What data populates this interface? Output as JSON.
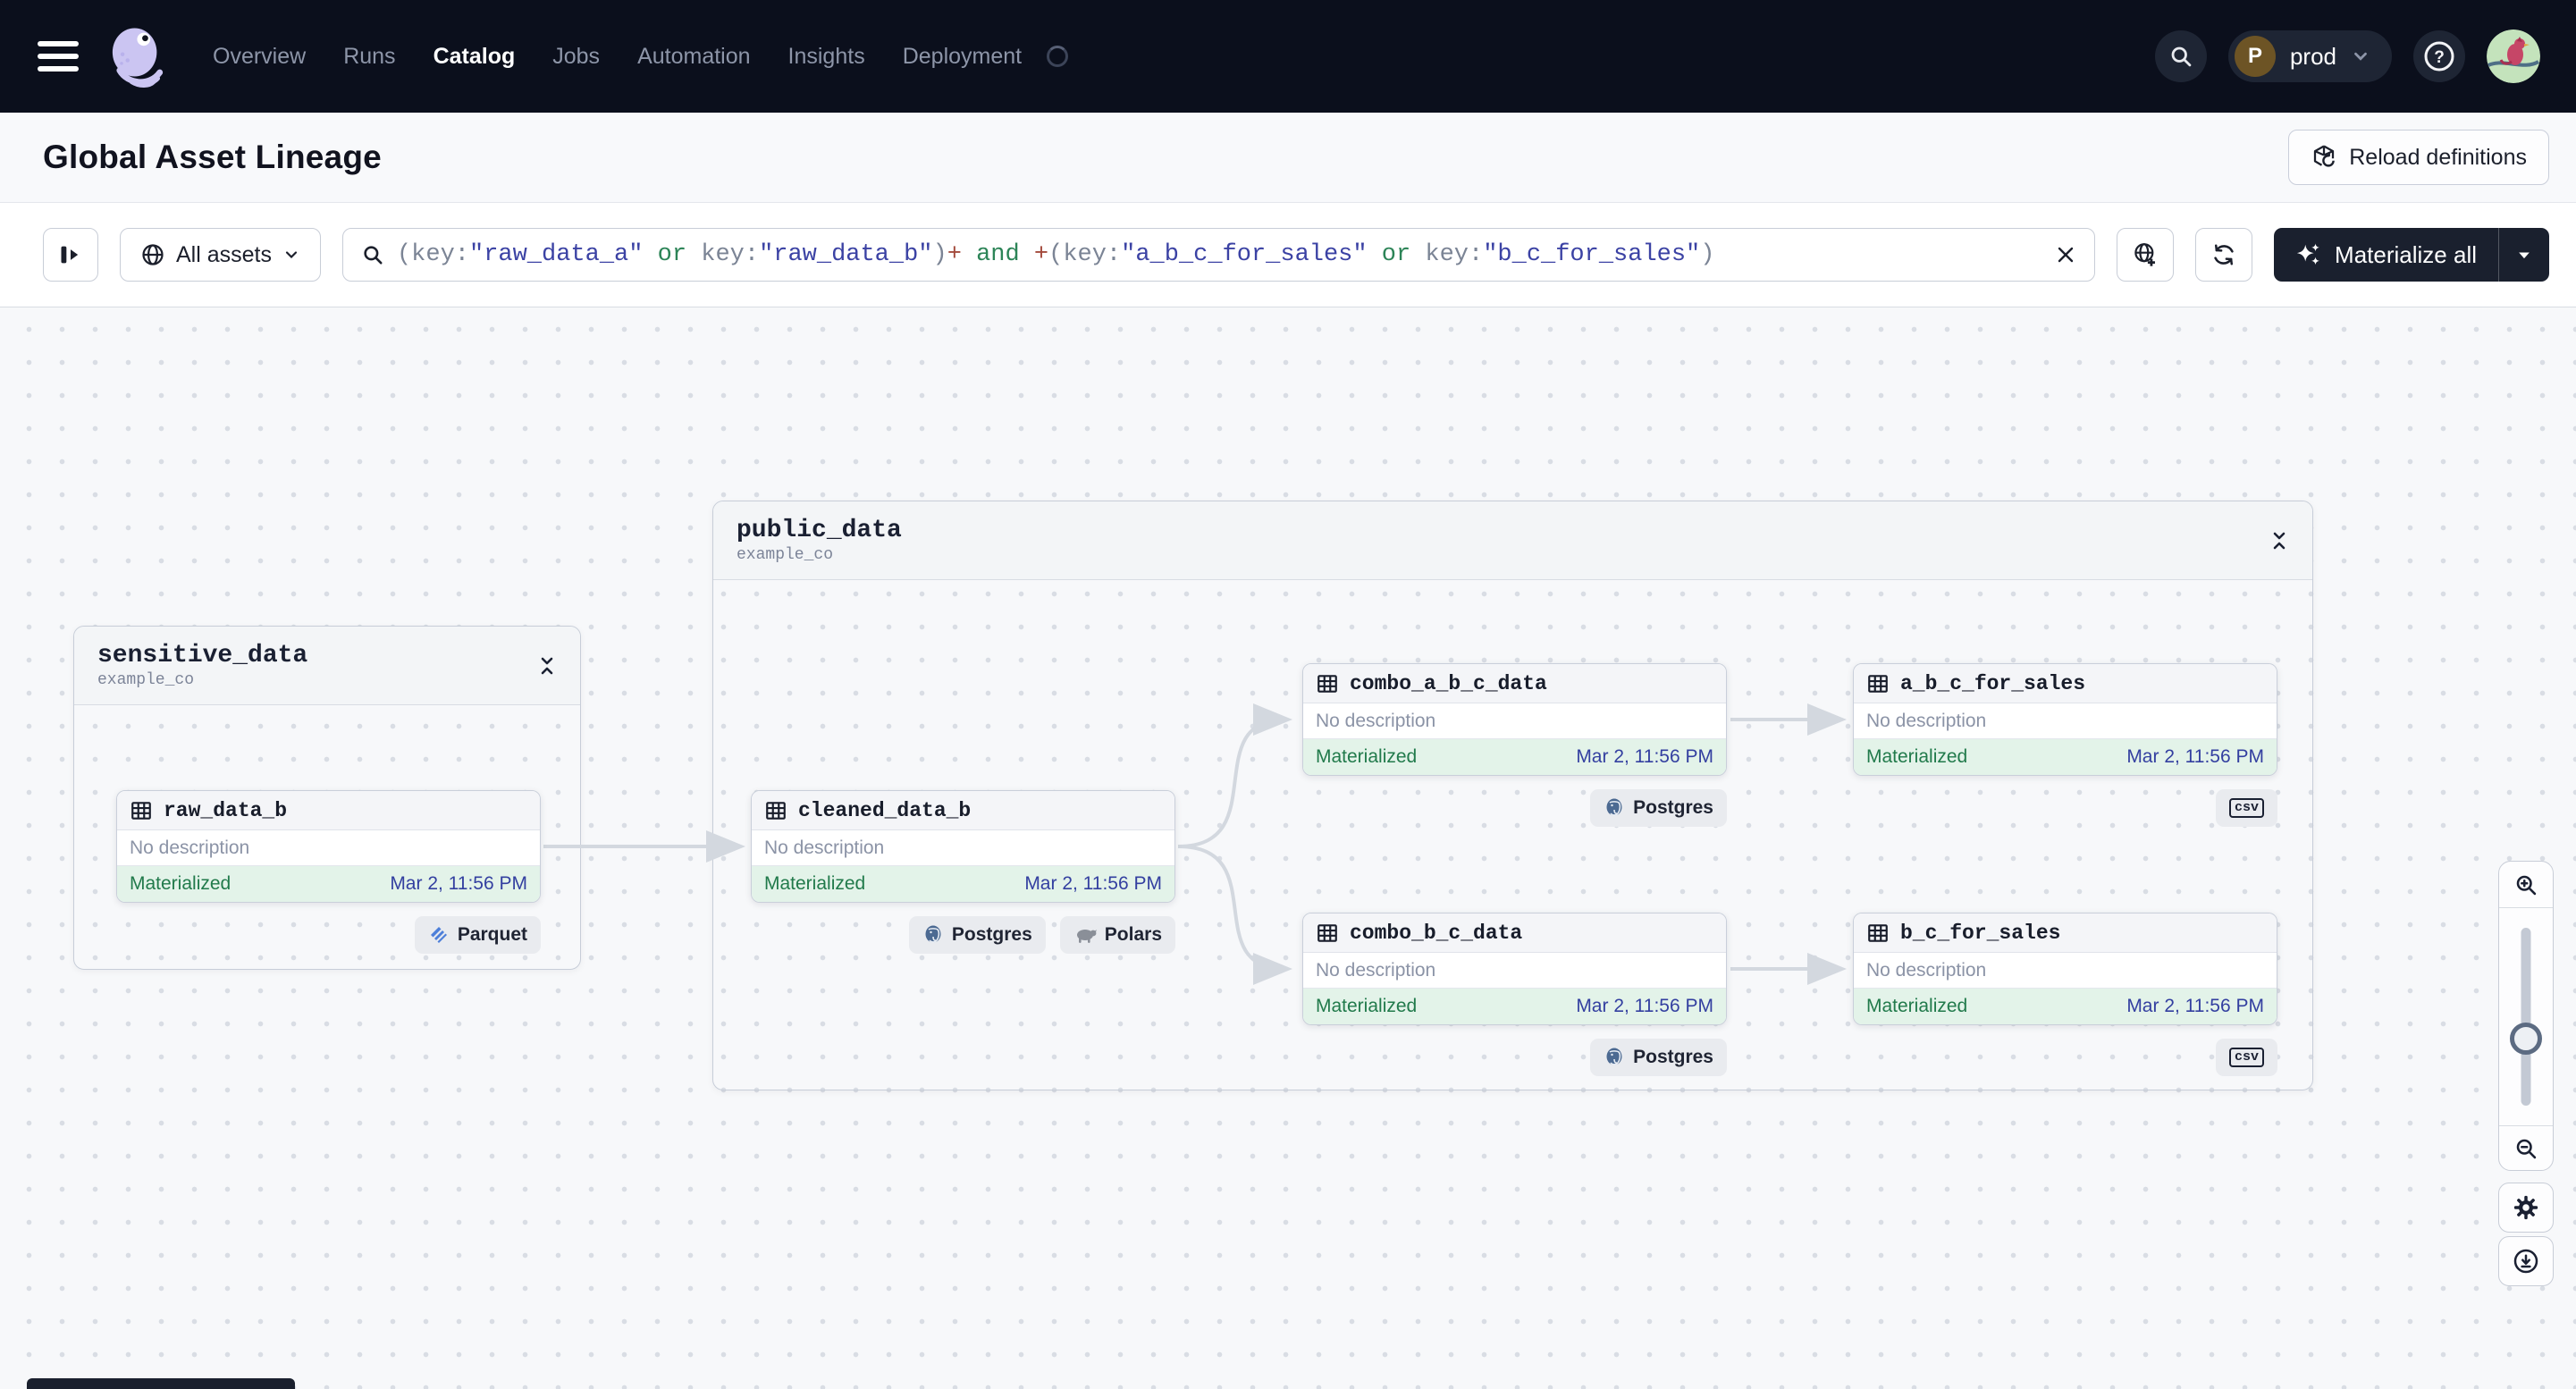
{
  "nav": {
    "items": [
      {
        "label": "Overview",
        "active": false
      },
      {
        "label": "Runs",
        "active": false
      },
      {
        "label": "Catalog",
        "active": true
      },
      {
        "label": "Jobs",
        "active": false
      },
      {
        "label": "Automation",
        "active": false
      },
      {
        "label": "Insights",
        "active": false
      },
      {
        "label": "Deployment",
        "active": false
      }
    ],
    "environment": {
      "initial": "P",
      "name": "prod"
    }
  },
  "header": {
    "title": "Global Asset Lineage",
    "reload_label": "Reload definitions"
  },
  "toolbar": {
    "scope_label": "All assets",
    "materialize_label": "Materialize all",
    "query": {
      "segments": [
        {
          "text": "(key:",
          "type": "punct"
        },
        {
          "text": "\"raw_data_a\"",
          "type": "string"
        },
        {
          "text": " or ",
          "type": "keyword"
        },
        {
          "text": "key:",
          "type": "punct"
        },
        {
          "text": "\"raw_data_b\"",
          "type": "string"
        },
        {
          "text": ")",
          "type": "punct"
        },
        {
          "text": "+",
          "type": "plus"
        },
        {
          "text": " and ",
          "type": "keyword"
        },
        {
          "text": "+",
          "type": "plus"
        },
        {
          "text": "(key:",
          "type": "punct"
        },
        {
          "text": "\"a_b_c_for_sales\"",
          "type": "string"
        },
        {
          "text": " or ",
          "type": "keyword"
        },
        {
          "text": "key:",
          "type": "punct"
        },
        {
          "text": "\"b_c_for_sales\"",
          "type": "string"
        },
        {
          "text": ")",
          "type": "punct"
        }
      ]
    }
  },
  "graph": {
    "groups": [
      {
        "name": "sensitive_data",
        "subtitle": "example_co"
      },
      {
        "name": "public_data",
        "subtitle": "example_co"
      }
    ],
    "nodes": [
      {
        "title": "raw_data_b",
        "description": "No description",
        "status": "Materialized",
        "timestamp": "Mar 2, 11:56 PM",
        "tags": [
          {
            "label": "Parquet",
            "icon": "parquet-icon"
          }
        ]
      },
      {
        "title": "cleaned_data_b",
        "description": "No description",
        "status": "Materialized",
        "timestamp": "Mar 2, 11:56 PM",
        "tags": [
          {
            "label": "Postgres",
            "icon": "postgres-icon"
          },
          {
            "label": "Polars",
            "icon": "polars-icon"
          }
        ]
      },
      {
        "title": "combo_a_b_c_data",
        "description": "No description",
        "status": "Materialized",
        "timestamp": "Mar 2, 11:56 PM",
        "tags": [
          {
            "label": "Postgres",
            "icon": "postgres-icon"
          }
        ]
      },
      {
        "title": "a_b_c_for_sales",
        "description": "No description",
        "status": "Materialized",
        "timestamp": "Mar 2, 11:56 PM",
        "tags": [
          {
            "label": "csv",
            "icon": "csv-icon"
          }
        ]
      },
      {
        "title": "combo_b_c_data",
        "description": "No description",
        "status": "Materialized",
        "timestamp": "Mar 2, 11:56 PM",
        "tags": [
          {
            "label": "Postgres",
            "icon": "postgres-icon"
          }
        ]
      },
      {
        "title": "b_c_for_sales",
        "description": "No description",
        "status": "Materialized",
        "timestamp": "Mar 2, 11:56 PM",
        "tags": [
          {
            "label": "csv",
            "icon": "csv-icon"
          }
        ]
      }
    ]
  },
  "colors": {
    "nav_bg": "#0B0F1C",
    "status_green_text": "#217A4B",
    "status_green_bg": "#E3F3E9",
    "timestamp_blue": "#333FA0",
    "query_string": "#3B42A4",
    "query_keyword": "#2C8457",
    "query_plus": "#A34A3C",
    "query_punct": "#7B8495",
    "materialize_bg": "#1A202E",
    "edge_gray": "#D3D8DF"
  }
}
